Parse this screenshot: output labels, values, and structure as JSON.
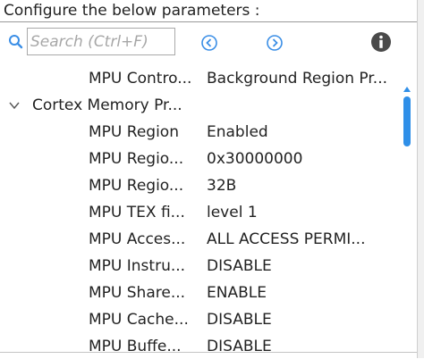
{
  "header": {
    "text": "Configure the below parameters :"
  },
  "toolbar": {
    "search_placeholder": "Search (Ctrl+F)",
    "search_value": "",
    "icons": {
      "search": "search-icon",
      "prev": "circle-left-icon",
      "next": "circle-right-icon",
      "info": "info-icon"
    }
  },
  "tree": {
    "rows": [
      {
        "name": "MPU Contro...",
        "value": "Background Region Pr..."
      },
      {
        "group": "Cortex Memory Pr...",
        "expanded": true
      },
      {
        "name": "MPU Region",
        "value": "Enabled"
      },
      {
        "name": "MPU Regio...",
        "value": "0x30000000"
      },
      {
        "name": "MPU Regio...",
        "value": "32B"
      },
      {
        "name": "MPU TEX fi...",
        "value": "level 1"
      },
      {
        "name": "MPU Acces...",
        "value": "ALL ACCESS PERMI..."
      },
      {
        "name": "MPU Instru...",
        "value": "DISABLE"
      },
      {
        "name": "MPU Share...",
        "value": "ENABLE"
      },
      {
        "name": "MPU Cache...",
        "value": "DISABLE"
      },
      {
        "name": "MPU Buffe...",
        "value": "DISABLE"
      }
    ]
  },
  "colors": {
    "accent": "#2f8fe8",
    "icon_blue": "#3a8ee6",
    "info_dark": "#4a4a4a"
  }
}
